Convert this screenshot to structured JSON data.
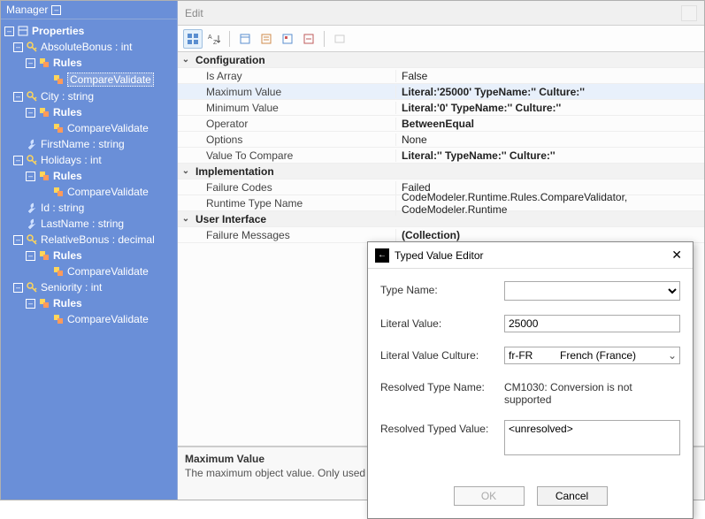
{
  "sidebar": {
    "title": "Manager",
    "root": "Properties",
    "items": [
      {
        "label": "AbsoluteBonus : int",
        "rules": "Rules",
        "child": "CompareValidate",
        "selected": true
      },
      {
        "label": "City : string",
        "rules": "Rules",
        "child": "CompareValidate"
      },
      {
        "label": "FirstName : string"
      },
      {
        "label": "Holidays : int",
        "rules": "Rules",
        "child": "CompareValidate"
      },
      {
        "label": "Id : string"
      },
      {
        "label": "LastName : string"
      },
      {
        "label": "RelativeBonus : decimal",
        "rules": "Rules",
        "child": "CompareValidate"
      },
      {
        "label": "Seniority : int",
        "rules": "Rules",
        "child": "CompareValidate"
      }
    ]
  },
  "right": {
    "header": "Edit",
    "categories": [
      {
        "name": "Configuration",
        "rows": [
          {
            "name": "Is Array",
            "value": "False"
          },
          {
            "name": "Maximum Value",
            "value": "Literal:'25000' TypeName:'' Culture:''",
            "bold": true
          },
          {
            "name": "Minimum Value",
            "value": "Literal:'0' TypeName:'' Culture:''",
            "bold": true
          },
          {
            "name": "Operator",
            "value": "BetweenEqual",
            "bold": true
          },
          {
            "name": "Options",
            "value": "None"
          },
          {
            "name": "Value To Compare",
            "value": "Literal:'' TypeName:'' Culture:''",
            "bold": true
          }
        ]
      },
      {
        "name": "Implementation",
        "rows": [
          {
            "name": "Failure Codes",
            "value": "Failed"
          },
          {
            "name": "Runtime Type Name",
            "value": "CodeModeler.Runtime.Rules.CompareValidator, CodeModeler.Runtime"
          }
        ]
      },
      {
        "name": "User Interface",
        "rows": [
          {
            "name": "Failure Messages",
            "value": "(Collection)",
            "bold": true
          }
        ]
      }
    ],
    "desc": {
      "title": "Maximum Value",
      "text": "The maximum object value. Only used for binary operators. The default is the literal 'MaxValue'."
    }
  },
  "dialog": {
    "title": "Typed Value Editor",
    "labels": {
      "typeName": "Type Name:",
      "literalValue": "Literal Value:",
      "literalCulture": "Literal Value Culture:",
      "resolvedType": "Resolved Type Name:",
      "resolvedValue": "Resolved Typed Value:"
    },
    "values": {
      "typeName": "",
      "literalValue": "25000",
      "cultureCode": "fr-FR",
      "cultureName": "French (France)",
      "resolvedType": "CM1030: Conversion is not supported",
      "resolvedValue": "<unresolved>"
    },
    "buttons": {
      "ok": "OK",
      "cancel": "Cancel"
    }
  }
}
